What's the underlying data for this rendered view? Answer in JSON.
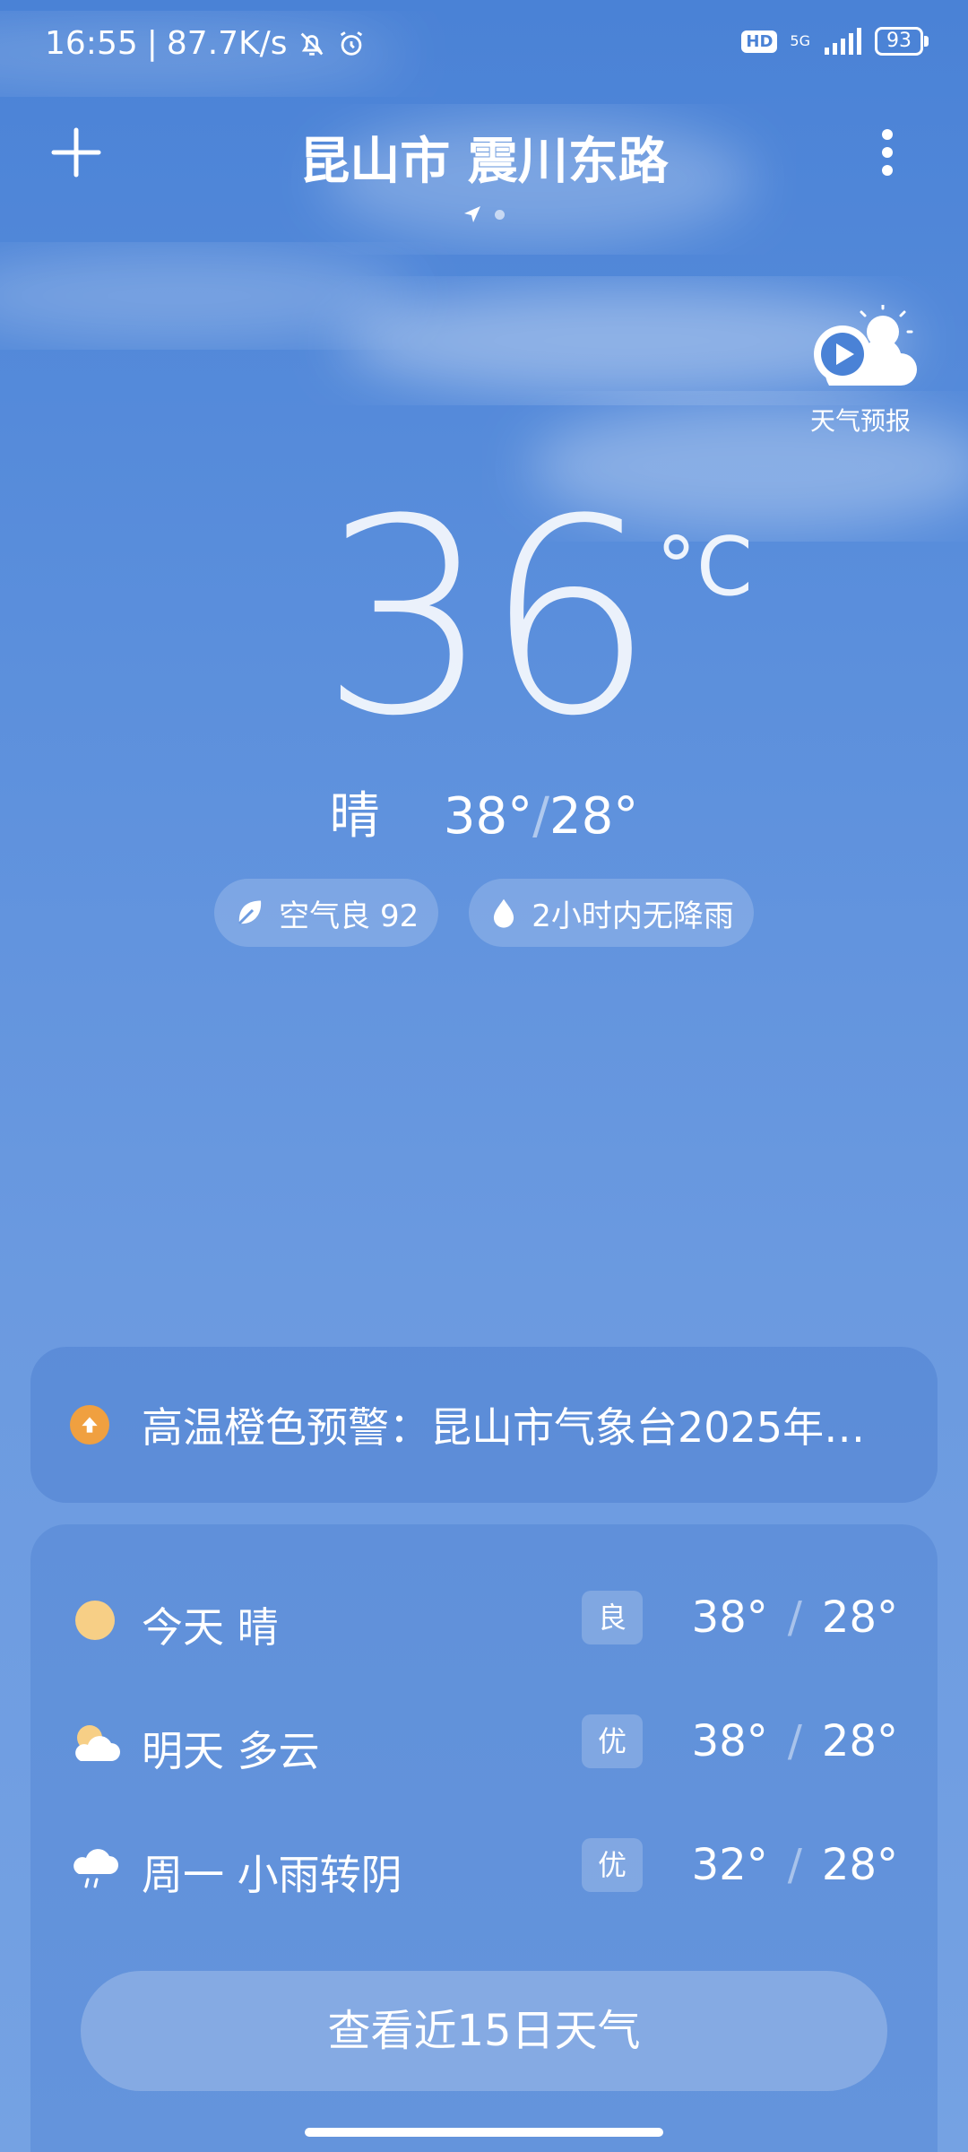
{
  "status_bar": {
    "time": "16:55",
    "separator": "|",
    "net_speed": "87.7K/s",
    "hd": "HD",
    "network": "5G",
    "battery": "93"
  },
  "header": {
    "location": "昆山市 震川东路"
  },
  "forecast_video": {
    "label": "天气预报"
  },
  "current": {
    "temp": "36",
    "unit": "°C",
    "condition": "晴",
    "high": "38°",
    "low": "28°",
    "slash": "/"
  },
  "pills": {
    "air_quality": "空气良 92",
    "rain": "2小时内无降雨"
  },
  "alert": {
    "text": "高温橙色预警：昆山市气象台2025年…"
  },
  "forecast": {
    "days": [
      {
        "label": "今天  晴",
        "icon": "sun-icon",
        "aq": "良",
        "high": "38°",
        "low": "28°"
      },
      {
        "label": "明天  多云",
        "icon": "partly-cloudy-icon",
        "aq": "优",
        "high": "38°",
        "low": "28°"
      },
      {
        "label": "周一  小雨转阴",
        "icon": "light-rain-icon",
        "aq": "优",
        "high": "32°",
        "low": "28°"
      }
    ],
    "slash": "/",
    "more_button": "查看近15日天气"
  },
  "colors": {
    "sky_top": "#4a82d6",
    "sky_bottom": "#75a2e3",
    "alert_orange": "#f0a040",
    "sun_yellow": "#f7cf86"
  }
}
